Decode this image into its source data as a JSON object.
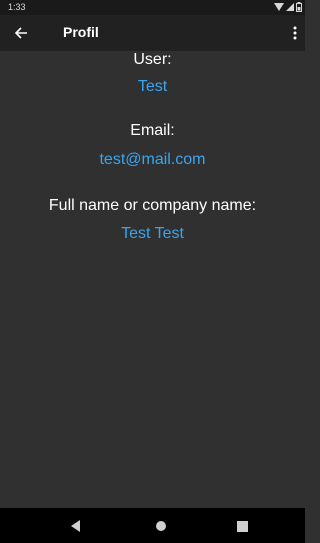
{
  "status_bar": {
    "time": "1:33",
    "icons": [
      "wifi-icon",
      "signal-icon",
      "battery-icon"
    ]
  },
  "app_bar": {
    "title": "Profil",
    "back_icon": "arrow-back-icon",
    "menu_icon": "more-vert-icon"
  },
  "profile": {
    "user_label": "User:",
    "user_value": "Test",
    "email_label": "Email:",
    "email_value": "test@mail.com",
    "name_label": "Full name or company name:",
    "name_value": "Test Test"
  },
  "nav_bar": {
    "icons": [
      "back-triangle-icon",
      "home-circle-icon",
      "recents-square-icon"
    ]
  },
  "colors": {
    "background": "#303030",
    "app_bar": "#212121",
    "status_bar": "#1a1a1a",
    "accent_value": "#3aa4f0",
    "nav_bar": "#000000"
  }
}
